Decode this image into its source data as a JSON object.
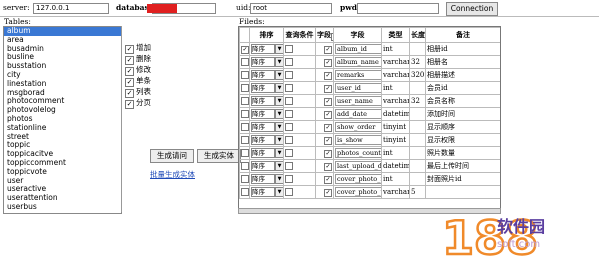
{
  "topbar": {
    "server_label": "server:",
    "server_value": "127.0.0.1",
    "database_label": "database:",
    "uid_label": "uid:",
    "uid_value": "root",
    "pwd_label": "pwd:",
    "connect_button": "Connection",
    "redaction_color": "#e02020"
  },
  "tables": {
    "label": "Tables:",
    "items": [
      "album",
      "area",
      "busadmin",
      "busline",
      "busstation",
      "city",
      "linestation",
      "msgborad",
      "photocomment",
      "photovolelog",
      "photos",
      "stationline",
      "street",
      "toppic",
      "toppicacitve",
      "toppiccomment",
      "toppicvote",
      "user",
      "useractive",
      "userattention",
      "userbus"
    ],
    "selected_index": 0
  },
  "operations": {
    "items": [
      {
        "label": "增加",
        "checked": true
      },
      {
        "label": "删除",
        "checked": true
      },
      {
        "label": "修改",
        "checked": true
      },
      {
        "label": "单条",
        "checked": true
      },
      {
        "label": "列表",
        "checked": true
      },
      {
        "label": "分页",
        "checked": true
      }
    ],
    "generate_query_button": "生成请问",
    "generate_entity_button": "生成实体",
    "batch_link": "批量生成实体"
  },
  "fields": {
    "label": "Fileds:",
    "headers": [
      "排序",
      "查询条件",
      "字段",
      "字段",
      "类型",
      "长度",
      "备注"
    ],
    "rows": [
      {
        "checked": true,
        "sort": "降序",
        "query": false,
        "field_checked": true,
        "name": "album_id",
        "type": "int",
        "length": "",
        "remark": "相册id"
      },
      {
        "checked": false,
        "sort": "降序",
        "query": false,
        "field_checked": true,
        "name": "album_name",
        "type": "varchar",
        "length": "32",
        "remark": "相册名"
      },
      {
        "checked": false,
        "sort": "降序",
        "query": false,
        "field_checked": true,
        "name": "remarks",
        "type": "varchar",
        "length": "320",
        "remark": "相册描述"
      },
      {
        "checked": false,
        "sort": "降序",
        "query": false,
        "field_checked": true,
        "name": "user_id",
        "type": "int",
        "length": "",
        "remark": "会员id"
      },
      {
        "checked": false,
        "sort": "降序",
        "query": false,
        "field_checked": true,
        "name": "user_name",
        "type": "varchar",
        "length": "32",
        "remark": "会员名称"
      },
      {
        "checked": false,
        "sort": "降序",
        "query": false,
        "field_checked": true,
        "name": "add_date",
        "type": "datetime",
        "length": "",
        "remark": "添加时间"
      },
      {
        "checked": false,
        "sort": "降序",
        "query": false,
        "field_checked": true,
        "name": "show_order",
        "type": "tinyint",
        "length": "",
        "remark": "显示顺序"
      },
      {
        "checked": false,
        "sort": "降序",
        "query": false,
        "field_checked": true,
        "name": "is_show",
        "type": "tinyint",
        "length": "",
        "remark": "显示权限"
      },
      {
        "checked": false,
        "sort": "降序",
        "query": false,
        "field_checked": true,
        "name": "photos_count",
        "type": "int",
        "length": "",
        "remark": "照片数量"
      },
      {
        "checked": false,
        "sort": "降序",
        "query": false,
        "field_checked": true,
        "name": "last_upload_date",
        "type": "datetime",
        "length": "",
        "remark": "最后上传时间"
      },
      {
        "checked": false,
        "sort": "降序",
        "query": false,
        "field_checked": true,
        "name": "cover_photo_id",
        "type": "int",
        "length": "",
        "remark": "封面照片id"
      },
      {
        "checked": false,
        "sort": "降序",
        "query": false,
        "field_checked": true,
        "name": "cover_photo_url",
        "type": "varchar",
        "length": "5",
        "remark": ""
      }
    ]
  },
  "watermark": {
    "number": "188",
    "name": "软件园",
    "domain": "soft.com"
  }
}
